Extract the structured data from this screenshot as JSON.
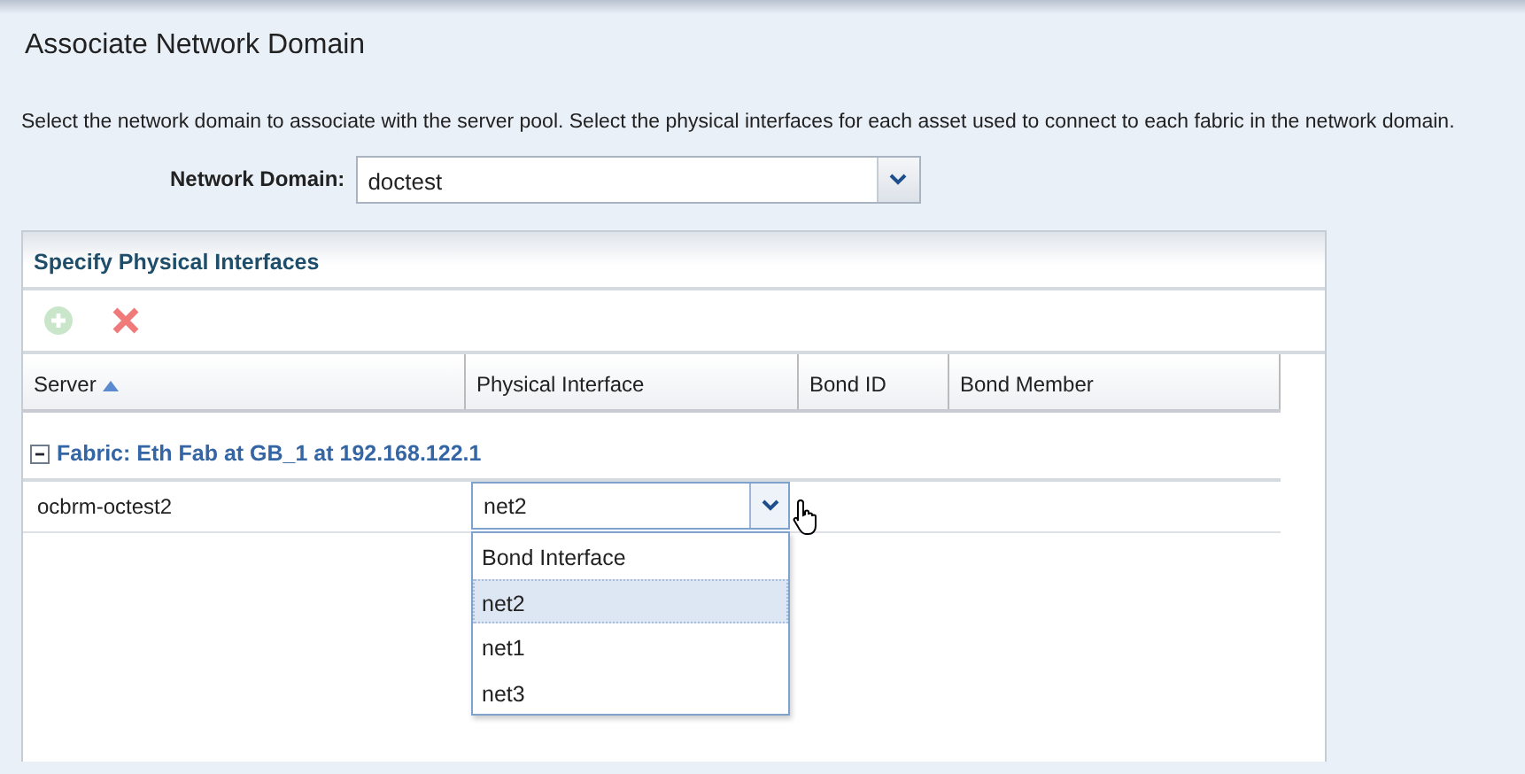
{
  "title": "Associate Network Domain",
  "description": "Select the network domain to associate with the server pool. Select the physical interfaces for each asset used to connect to each fabric in the network domain.",
  "network_domain": {
    "label": "Network Domain:",
    "value": "doctest"
  },
  "panel": {
    "title": "Specify Physical Interfaces",
    "toolbar": [
      {
        "kind": "add",
        "disabled": true
      },
      {
        "kind": "remove",
        "disabled": false
      }
    ],
    "columns": [
      {
        "label": "Server",
        "sorted": true
      },
      {
        "label": "Physical Interface",
        "sorted": false
      },
      {
        "label": "Bond ID",
        "sorted": false
      },
      {
        "label": "Bond Member",
        "sorted": false
      }
    ],
    "groups": [
      {
        "label": "Fabric: Eth Fab at GB_1 at 192.168.122.1",
        "expanded": true,
        "rows": [
          {
            "server": "ocbrm-octest2",
            "interface": "net2",
            "open": true,
            "options": [
              {
                "label": "Bond Interface",
                "selected": false
              },
              {
                "label": "net2",
                "selected": true
              },
              {
                "label": "net1",
                "selected": false
              },
              {
                "label": "net3",
                "selected": false
              }
            ]
          }
        ]
      }
    ]
  }
}
